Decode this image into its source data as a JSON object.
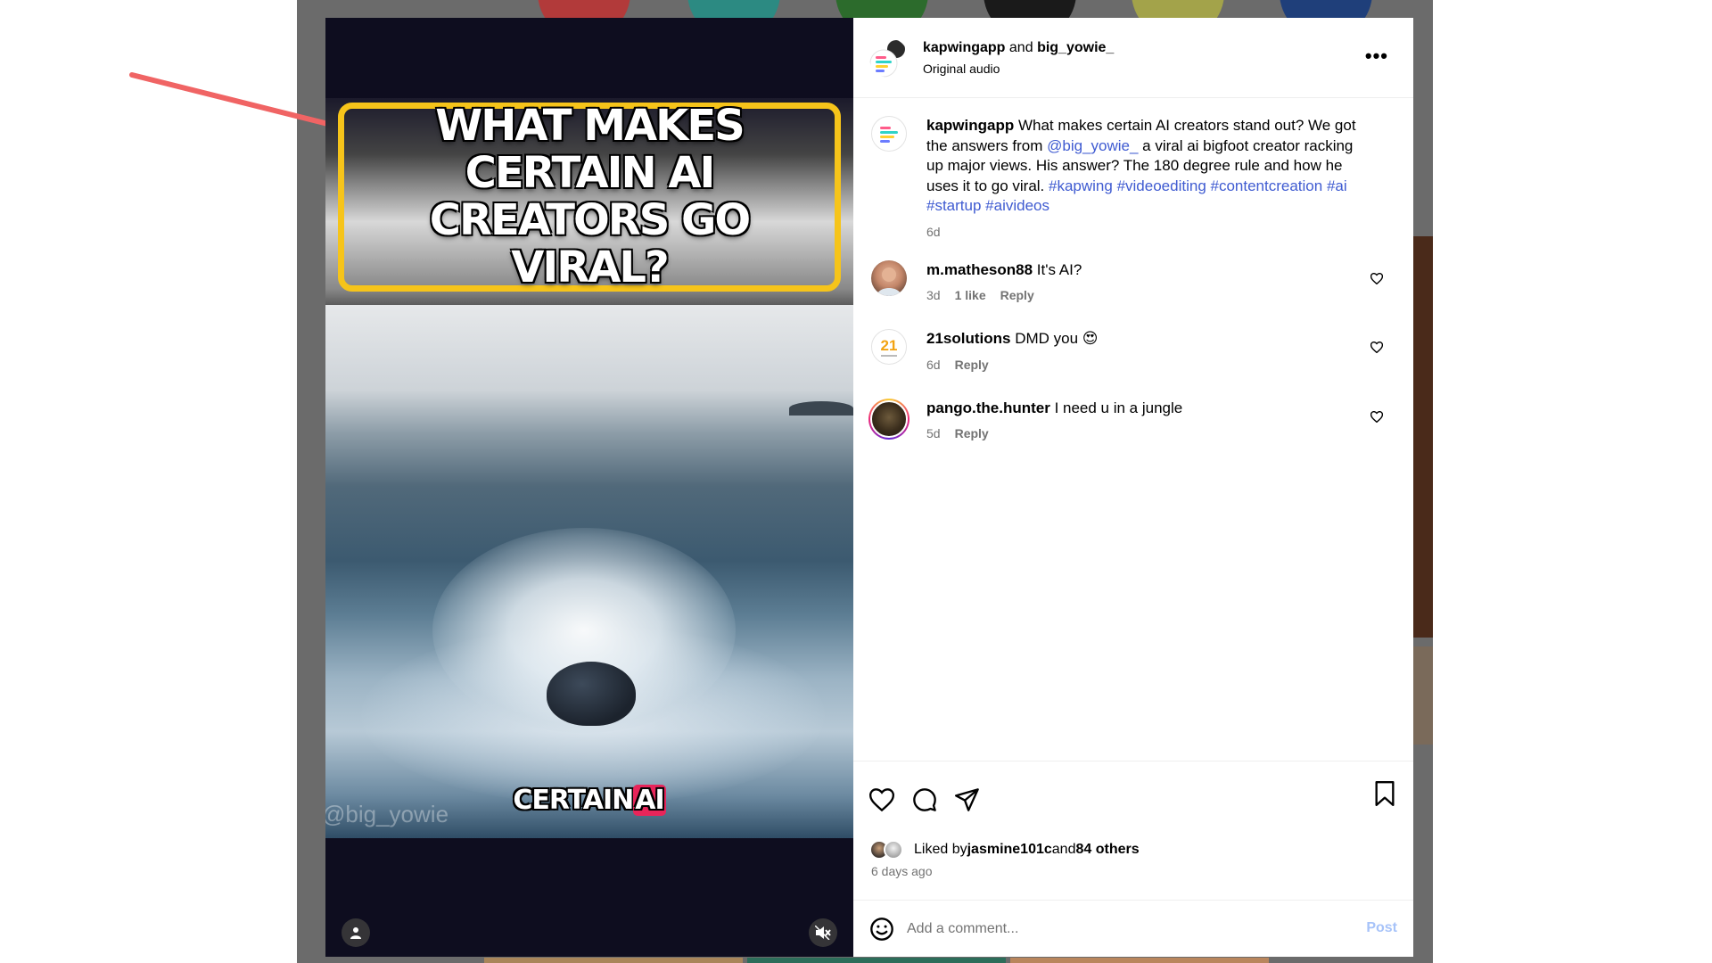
{
  "post": {
    "author_primary": "kapwingapp",
    "connector": "and",
    "author_secondary": "big_yowie_",
    "audio": "Original audio",
    "more_label": "•••"
  },
  "media": {
    "headline": "WHAT MAKES CERTAIN AI CREATORS GO VIRAL?",
    "caption_plain": "CERTAIN",
    "caption_highlight": "AI",
    "watermark": "@big_yowie"
  },
  "caption": {
    "user": "kapwingapp",
    "text_part1": " What makes certain AI creators stand out? We got the answers from ",
    "mention": "@big_yowie_",
    "text_part2": " a viral ai bigfoot creator racking up major views. His answer? The 180 degree rule and how he uses it to go viral. ",
    "hashtags": [
      "#kapwing",
      "#videoediting",
      "#contentcreation",
      "#ai",
      "#startup",
      "#aivideos"
    ],
    "time": "6d"
  },
  "comments": [
    {
      "user": "m.matheson88",
      "text": "It's AI?",
      "time": "3d",
      "likes": "1 like",
      "reply": "Reply"
    },
    {
      "user": "21solutions",
      "text": "DMD you 😍",
      "time": "6d",
      "likes": "",
      "reply": "Reply"
    },
    {
      "user": "pango.the.hunter",
      "text": "I need u in a jungle",
      "time": "5d",
      "likes": "",
      "reply": "Reply"
    }
  ],
  "solutions_avatar_text": "21",
  "likes": {
    "prefix": "Liked by ",
    "user": "jasmine101c",
    "middle": " and ",
    "others": "84 others"
  },
  "time_ago": "6 days ago",
  "comment_box": {
    "placeholder": "Add a comment...",
    "post_label": "Post"
  },
  "colors": {
    "accent_link": "#3f5bd1",
    "arrow": "#f06464",
    "headline_border": "#f6c41a",
    "post_disabled": "#a7c3f9"
  }
}
